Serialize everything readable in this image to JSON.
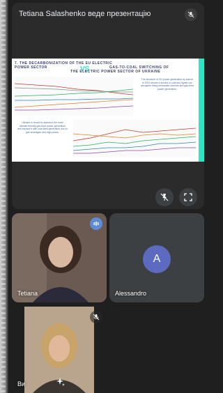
{
  "presentation": {
    "title": "Tetiana Salashenko веде презентацію",
    "slide": {
      "heading_left_line1": "7. THE DECARBONIZATION OF THE EU ELECTRIC",
      "heading_left_line2": "POWER SECTOR",
      "vs": "VS",
      "heading_right_line1": "GAS-TO-COAL SWITCHING OF",
      "heading_right_line2": "THE ELECTRIC POWER SECTOR OF UKRAINE",
      "eu_text": "The structure of EU power generation by source in 2019 shows a decline in coal and lignite use alongside rising renewable sources and gas-fired power generation.",
      "ua_text": "Ukraine is forced to abandon the more climate-friendly gas-fired power generation and replace it with coal-fired generation due to gas shortages and high prices."
    },
    "controls": {
      "unpin_icon": "pin-off-icon",
      "fullscreen_icon": "fullscreen-icon"
    }
  },
  "participants": [
    {
      "name": "Tetiana",
      "badge": "audio-level-icon"
    },
    {
      "name": "Alessandro",
      "initial": "A"
    },
    {
      "name": "Ви",
      "badge": "mic-off-icon"
    }
  ],
  "colors": {
    "background": "#1f1f1f",
    "tile": "#3c4043",
    "avatar": "#5c6bc0",
    "slide_accent": "#2ee6c3"
  }
}
